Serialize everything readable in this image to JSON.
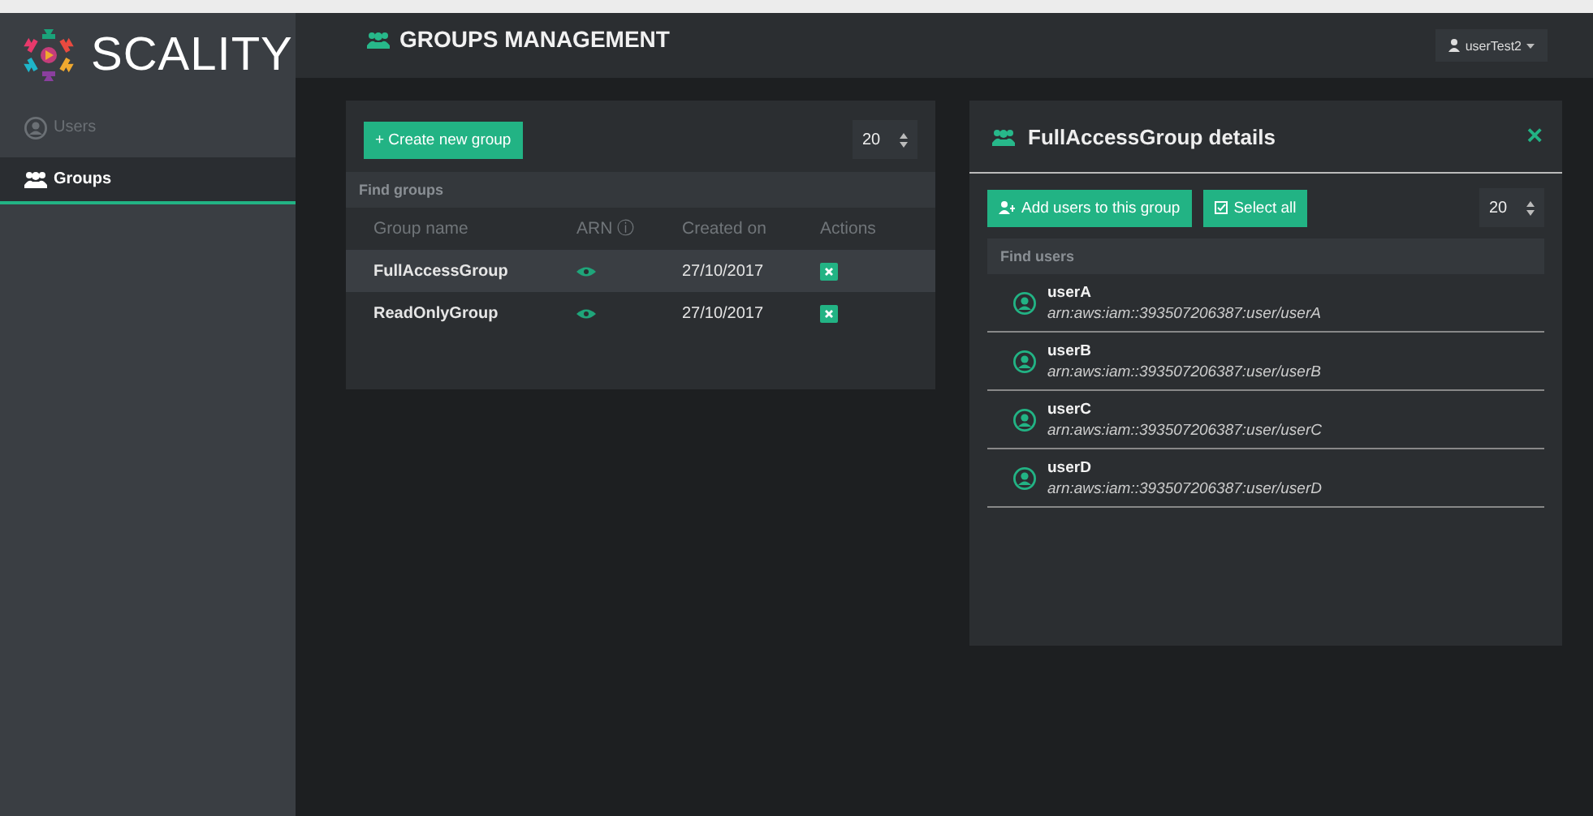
{
  "logo": {
    "text": "SCALITY"
  },
  "sidebar": {
    "items": [
      {
        "label": "Users",
        "kind": "user",
        "selected": false
      },
      {
        "label": "Groups",
        "kind": "group",
        "selected": true
      }
    ]
  },
  "header": {
    "title": "GROUPS MANAGEMENT",
    "user_menu": "userTest2"
  },
  "groups_panel": {
    "create_button": "+ Create new group",
    "page_size": "20",
    "search": {
      "placeholder": "Find groups"
    },
    "table": {
      "columns": [
        "Group name",
        "ARN ⓘ",
        "Created on",
        "Actions"
      ],
      "rows": [
        {
          "name": "FullAccessGroup",
          "created": "27/10/2017",
          "selected": true
        },
        {
          "name": "ReadOnlyGroup",
          "created": "27/10/2017",
          "selected": false
        }
      ]
    }
  },
  "details_panel": {
    "title": "FullAccessGroup details",
    "close": "×",
    "add_button": "Add users to this group",
    "select_all_button": "Select all",
    "page_size": "20",
    "search": {
      "placeholder": "Find users"
    },
    "users": [
      {
        "name": "userA",
        "arn": "arn:aws:iam::393507206387:user/userA"
      },
      {
        "name": "userB",
        "arn": "arn:aws:iam::393507206387:user/userB"
      },
      {
        "name": "userC",
        "arn": "arn:aws:iam::393507206387:user/userC"
      },
      {
        "name": "userD",
        "arn": "arn:aws:iam::393507206387:user/userD"
      }
    ]
  }
}
